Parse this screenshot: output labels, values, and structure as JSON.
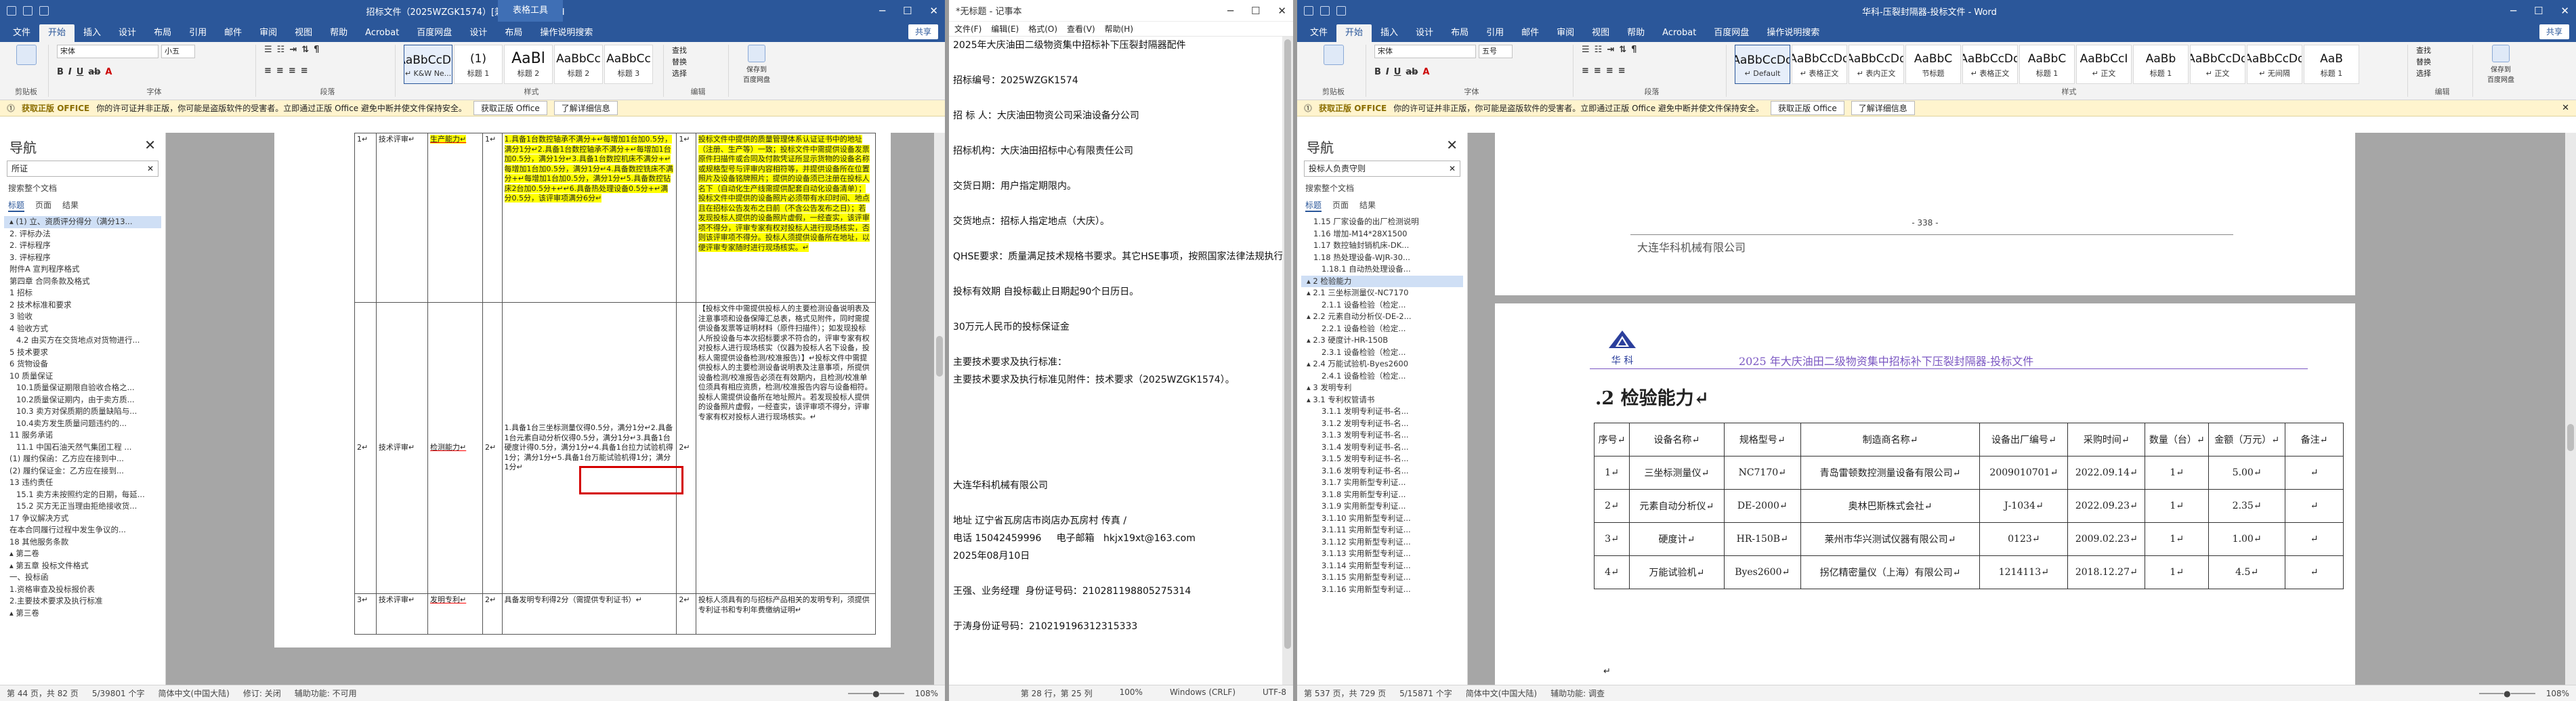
{
  "w1": {
    "title": "招标文件（2025WZGK1574）[兼容模式] - Word",
    "tools_label": "表格工具",
    "tabs": [
      "文件",
      "开始",
      "插入",
      "设计",
      "布局",
      "引用",
      "邮件",
      "审阅",
      "视图",
      "帮助",
      "Acrobat",
      "百度网盘",
      "设计",
      "布局",
      "操作说明搜索"
    ],
    "share": "共享",
    "font_name": "宋体",
    "font_size": "小五",
    "styles": [
      {
        "pv": "AaBbCcDd",
        "name": "↵ K&W Ne..."
      },
      {
        "pv": "(1)",
        "name": "标题 1"
      },
      {
        "pv": "AaBl",
        "name": "标题 2"
      },
      {
        "pv": "AaBbCc",
        "name": "标题 2"
      },
      {
        "pv": "AaBbCc",
        "name": "标题 3"
      }
    ],
    "edit": [
      "查找",
      "替换",
      "选择"
    ],
    "save": "保存到\n百度网盘",
    "groups": [
      "剪贴板",
      "字体",
      "段落",
      "样式",
      "编辑",
      "保存"
    ],
    "msg": {
      "label": "获取正版 OFFICE",
      "text": "你的许可证并非正版，你可能是盗版软件的受害者。立即通过正版 Office 避免中断并使文件保持安全。",
      "b1": "获取正版 Office",
      "b2": "了解详细信息"
    },
    "nav": {
      "title": "导航",
      "search": "所证",
      "sub": "搜索整个文档",
      "tabs": [
        "标题",
        "页面",
        "结果"
      ],
      "items": [
        "▴ (1) 立、资质评分得分（满分13...",
        "2. 评标办法",
        "2. 评标程序",
        "3. 评标程序",
        "附件A 宣判程序格式",
        "第四章 合同条款及格式",
        "1 招标",
        "2 技术标准和要求",
        "3 验收",
        "4 验收方式",
        "4.2 由买方在交货地点对货物进行...",
        "5 技术要求",
        "6 货物设备",
        "10 质量保证",
        "10.1质量保证期限自验收合格之...",
        "10.2质量保证期内，由于卖方质...",
        "10.3 卖方对保质期的质量缺陷与...",
        "10.4卖方发生质量问题违约的...",
        "11 服务承诺",
        "11.1 中国石油天然气集团工程 ...",
        "(1) 履约保函：乙方应在接到中...",
        "(2) 履约保证金：乙方应在接到...",
        "13 违约责任",
        "15.1 卖方未按照约定的日期，每延...",
        "15.2 买方无正当理由拒绝接收货...",
        "17 争议解决方式",
        "在本合同履行过程中发生争议的...",
        "18 其他服务条款",
        "▴ 第二卷",
        "▴ 第五章 投标文件格式",
        "一、投标函",
        "1.资格审查及投标报价表",
        "2.主要技术要求及执行标准",
        "▴ 第三卷"
      ]
    },
    "table": {
      "r1": {
        "no": "1↵",
        "cat": "技术评审↵",
        "item": "生产能力↵",
        "score": "1↵",
        "crit": "1.具备1台数控轴承不满分+↵每增加1台加0.5分，满分1分↵2.具备1台数控轴承不满分+↵每增加1台加0.5分，满分1分↵3.具备1台数控机床不满分+↵每增加1台加0.5分，满分1分↵4.具备数控铣床不满分+↵每增加1台加0.5分，满分1分↵5.具备数控钻床2台加0.5分+↵↵6.具备热处理设备0.5分+↵满分0.5分，该评审项满分6分↵",
        "req": "投标文件中提供的质量管理体系认证证书中的地址（注册、生产等）一致；投标文件中需提供设备发票原件扫描件或合同及付款凭证所显示货物的设备名称或规格型号与评审内容相符等，并提供设备所在位置照片及设备铭牌照片；提供的设备须已注册在投标人名下（自动化生产线需提供配套自动化设备清单）；投标文件中提供的设备照片必须带有水印时间、地点且在招标公告发布之日前（不含公告发布之日）；若发现投标人提供的设备照片虚假，一经查实，该评审项不得分，评审专家有权对投标人进行现场核实，否则该评审项不得分。投标人须提供设备所在地址，以便评审专家随时进行现场核实。↵"
      },
      "r2": {
        "no": "2↵",
        "cat": "技术评审↵",
        "item": "检测能力↵",
        "score": "2↵",
        "crit": "1.具备1台三坐标测量仪得0.5分，满分1分↵2.具备1台元素自动分析仪得0.5分，满分1分↵3.具备1台硬度计得0.5分，满分1分↵4.具备1台拉力试验机得1分；满分1分↵5.具备1台万能试验机得1分；满分1分↵",
        "req": "【投标文件中需提供投标人的主要检测设备说明表及注意事项和设备保障汇总表，格式见附件，同时需提供设备发票等证明材料（原件扫描件）；如发现投标人所投设备与本次招标要求不符合的，评审专家有权对投标人进行现场核实（仪器为投标人名下设备，投标人需提供设备检测/校准报告）】↵投标文件中需提供投标人的主要检测设备说明表及注意事项，所提供设备检测/校准报告必须在有效期内，且检测/校准单位须具有相应资质，检测/校准报告内容与设备相符。投标人需提供设备所在地址照片。若发现投标人提供的设备照片虚假，一经查实，该评审项不得分，评审专家有权对投标人进行现场核实。↵"
      },
      "r3": {
        "no": "3↵",
        "cat": "技术评审↵",
        "item": "发明专利↵",
        "score": "2↵",
        "crit": "具备发明专利得2分（需提供专利证书）↵",
        "req": "投标人须具有的与招标产品相关的发明专利，须提供专利证书和专利年费缴纳证明↵"
      }
    },
    "status": {
      "left": "第 44 页，共 82 页",
      "words": "5/39801 个字",
      "lang": "简体中文(中国大陆)",
      "fix": "修订: 关闭",
      "acc": "辅助功能: 不可用",
      "zoom": "108%"
    }
  },
  "w2": {
    "title": "*无标题 - 记事本",
    "menu": [
      "文件(F)",
      "编辑(E)",
      "格式(O)",
      "查看(V)",
      "帮助(H)"
    ],
    "lines": [
      "2025年大庆油田二级物资集中招标补下压裂封隔器配件",
      "",
      "招标编号：2025WZGK1574",
      "",
      "招 标 人：大庆油田物资公司采油设备分公司",
      "",
      "招标机构：大庆油田招标中心有限责任公司",
      "",
      "交货日期：用户指定期限内。",
      "",
      "交货地点：招标人指定地点（大庆）。",
      "",
      "QHSE要求：质量满足技术规格书要求。其它HSE事项，按照国家法律法规执行。",
      "",
      "投标有效期 自投标截止日期起90个日历日。",
      "",
      "30万元人民币的投标保证金",
      "",
      "主要技术要求及执行标准：",
      "主要技术要求及执行标准见附件：技术要求（2025WZGK1574）。",
      "",
      "",
      "",
      "",
      "",
      "大连华科机械有限公司",
      "",
      "地址 辽宁省瓦房店市岗店办瓦房村 传真 /",
      "电话 15042459996     电子邮箱   hkjx19xt@163.com",
      "2025年08月10日",
      "",
      "王强、业务经理  身份证号码：210281198805275314",
      "",
      "于涛身份证号码：210219196312315333"
    ],
    "status": {
      "pos": "第 28 行，第 25 列",
      "zoom": "100%",
      "eol": "Windows (CRLF)",
      "enc": "UTF-8"
    }
  },
  "w3": {
    "title": "华科-压裂封隔器-投标文件 - Word",
    "tabs": [
      "文件",
      "开始",
      "插入",
      "设计",
      "布局",
      "引用",
      "邮件",
      "审阅",
      "视图",
      "帮助",
      "Acrobat",
      "百度网盘",
      "操作说明搜索"
    ],
    "share": "共享",
    "font_name": "宋体",
    "font_size": "五号",
    "styles": [
      {
        "pv": "AaBbCcDd",
        "name": "↵ Default"
      },
      {
        "pv": "AaBbCcDd",
        "name": "↵ 表格正文"
      },
      {
        "pv": "AaBbCcDd",
        "name": "↵ 表内正文"
      },
      {
        "pv": "AaBbC",
        "name": "节标题"
      },
      {
        "pv": "AaBbCcDd",
        "name": "↵ 表格正文"
      },
      {
        "pv": "AaBbC",
        "name": "标题 1"
      },
      {
        "pv": "AaBbCcI",
        "name": "↵ 正文"
      },
      {
        "pv": "AaBb",
        "name": "标题 1"
      },
      {
        "pv": "AaBbCcDd",
        "name": "↵ 正文"
      },
      {
        "pv": "AaBbCcDd",
        "name": "↵ 无间隔"
      },
      {
        "pv": "AaB",
        "name": "标题 1"
      }
    ],
    "msg": {
      "label": "获取正版 OFFICE",
      "text": "你的许可证并非正版，你可能是盗版软件的受害者。立即通过正版 Office 避免中断并使文件保持安全。",
      "b1": "获取正版 Office",
      "b2": "了解详细信息"
    },
    "nav": {
      "title": "导航",
      "search": "投标人负责守则",
      "sub": "搜索整个文档",
      "tabs": [
        "标题",
        "页面",
        "结果"
      ],
      "items": [
        "1.15 厂家设备的出厂检测说明",
        "1.16 增加-M14*28X1500",
        "1.17 数控轴封销机床-DK...",
        "1.18 热处理设备-WJR-30...",
        "1.18.1 自动热处理设备...",
        "▴ 2 检验能力",
        "▴ 2.1 三坐标测量仪-NC7170",
        "2.1.1 设备检验（检定...",
        "▴ 2.2 元素自动分析仪-DE-2...",
        "2.2.1 设备检验（检定...",
        "▴ 2.3 硬度计-HR-150B",
        "2.3.1 设备检验（检定...",
        "▴ 2.4 万能试验机-Byes2600",
        "2.4.1 设备检验（检定...",
        "▴ 3 发明专利",
        "▴ 3.1 专利权管请书",
        "3.1.1 发明专利证书-名...",
        "3.1.2 发明专利证书-名...",
        "3.1.3 发明专利证书-名...",
        "3.1.4 发明专利证书-名...",
        "3.1.5 发明专利证书-名...",
        "3.1.6 发明专利证书-名...",
        "3.1.7 实用新型专利证...",
        "3.1.8 实用新型专利证...",
        "3.1.9 实用新型专利证...",
        "3.1.10 实用新型专利证...",
        "3.1.11 实用新型专利证...",
        "3.1.12 实用新型专利证...",
        "3.1.13 实用新型专利证...",
        "3.1.14 实用新型专利证...",
        "3.1.15 实用新型专利证...",
        "3.1.16 实用新型专利证..."
      ]
    },
    "page1": {
      "pagenum": "- 338 -",
      "footer_company": "大连华科机械有限公司"
    },
    "page2": {
      "logo_text": "华  科",
      "header": "2025 年大庆油田二级物资集中招标补下压裂封隔器-投标文件",
      "heading": ".2  检验能力↵",
      "cols": [
        "序号↵",
        "设备名称↵",
        "规格型号↵",
        "制造商名称↵",
        "设备出厂编号↵",
        "采购时间↵",
        "数量（台）↵",
        "金额（万元）↵",
        "备注↵"
      ],
      "rows": [
        [
          "1↵",
          "三坐标测量仪↵",
          "NC7170↵",
          "青岛雷顿数控测量设备有限公司↵",
          "2009010701↵",
          "2022.09.14↵",
          "1↵",
          "5.00↵",
          "↵"
        ],
        [
          "2↵",
          "元素自动分析仪↵",
          "DE-2000↵",
          "奥林巴斯株式会社↵",
          "J-1034↵",
          "2022.09.23↵",
          "1↵",
          "2.35↵",
          "↵"
        ],
        [
          "3↵",
          "硬度计↵",
          "HR-150B↵",
          "莱州市华兴测试仪器有限公司↵",
          "0123↵",
          "2009.02.23↵",
          "1↵",
          "1.00↵",
          "↵"
        ],
        [
          "4↵",
          "万能试验机↵",
          "Byes2600↵",
          "拐亿精密量仪（上海）有限公司↵",
          "1214113↵",
          "2018.12.27↵",
          "1↵",
          "4.5↵",
          "↵"
        ]
      ]
    },
    "status": {
      "left": "第 537 页，共 729 页",
      "words": "5/15871 个字",
      "lang": "简体中文(中国大陆)",
      "acc": "辅助功能: 调查",
      "zoom": "108%"
    }
  },
  "colors": {
    "word_blue": "#2b579a",
    "highlight": "#ffff00",
    "red": "#d40000"
  }
}
